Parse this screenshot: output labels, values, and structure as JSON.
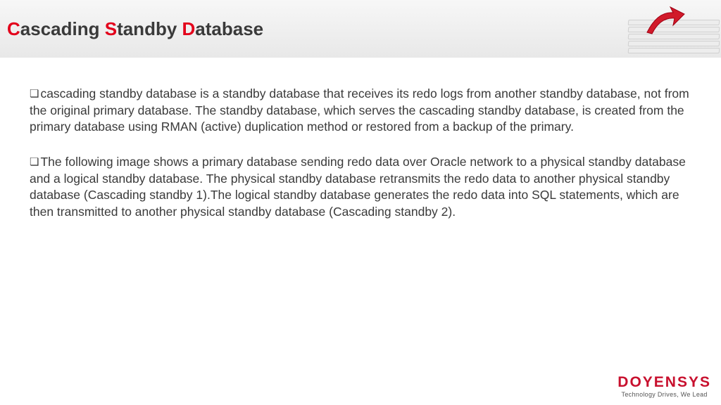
{
  "title": {
    "c1": "C",
    "w1": "ascading ",
    "c2": "S",
    "w2": "tandby ",
    "c3": "D",
    "w3": "atabase"
  },
  "paragraphs": {
    "p1": "cascading standby database is a standby database that receives its redo logs from another standby database, not from the original primary database. The standby database, which serves the cascading standby database, is created from the primary database using RMAN (active) duplication method or restored from a backup of the primary.",
    "p2": "The following image shows a primary database sending redo data over Oracle network to a physical standby database and a logical standby database. The physical standby database retransmits the redo data to another physical standby database (Cascading standby 1).The logical standby database generates the redo data into SQL statements, which are then transmitted to another physical standby database (Cascading standby 2)."
  },
  "footer": {
    "brand": "DOYENSYS",
    "tagline": "Technology Drives, We Lead"
  },
  "bullet_glyph": "❏"
}
